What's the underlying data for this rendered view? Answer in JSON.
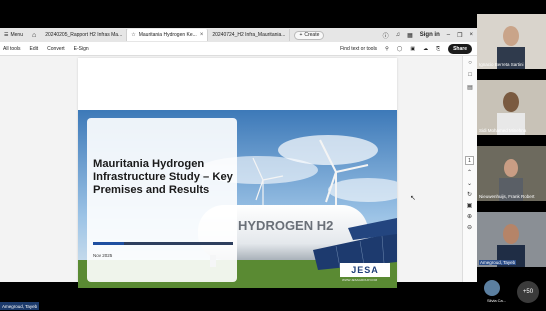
{
  "tabbar": {
    "menu_label": "Menu",
    "tabs": [
      {
        "label": "20240205_Rapport H2 Infras Ma...",
        "active": false
      },
      {
        "label": "Mauritania Hydrogen Ke...",
        "active": true
      },
      {
        "label": "20240724_H2 Infra_Mauritania...",
        "active": false
      }
    ],
    "create_label": "Create",
    "signin_label": "Sign in"
  },
  "toolbar": {
    "items": [
      "All tools",
      "Edit",
      "Convert",
      "E-Sign"
    ],
    "find_label": "Find text or tools",
    "share_label": "Share"
  },
  "slide": {
    "title": "Mauritania Hydrogen Infrastructure Study – Key Premises and Results",
    "date": "Nov 2025",
    "progress_fraction": 0.22,
    "tank_text": "HYDROGEN H2",
    "logo_text": "JESA",
    "logo_url": "WWW.JESAGROUP.COM"
  },
  "pager": {
    "page_number": "1"
  },
  "participants": [
    {
      "name": "Ignacio Berreta Sartini",
      "skin": "#c9a489",
      "bg": "#d9d4cc"
    },
    {
      "name": "Sidi Mohamed Minehna",
      "skin": "#7a5a40",
      "bg": "#c8c2b7"
    },
    {
      "name": "Nieuwenhuijs, Frank Robert",
      "skin": "#c99d84",
      "bg": "#6d6a5e"
    },
    {
      "name": "Amegroud, Tayeb",
      "skin": "#b58468",
      "bg": "#8a8f95"
    }
  ],
  "more_count": "+50",
  "silvia_name": "Silvia Ca...",
  "presenter_name": "Amegroud, Tayeb"
}
